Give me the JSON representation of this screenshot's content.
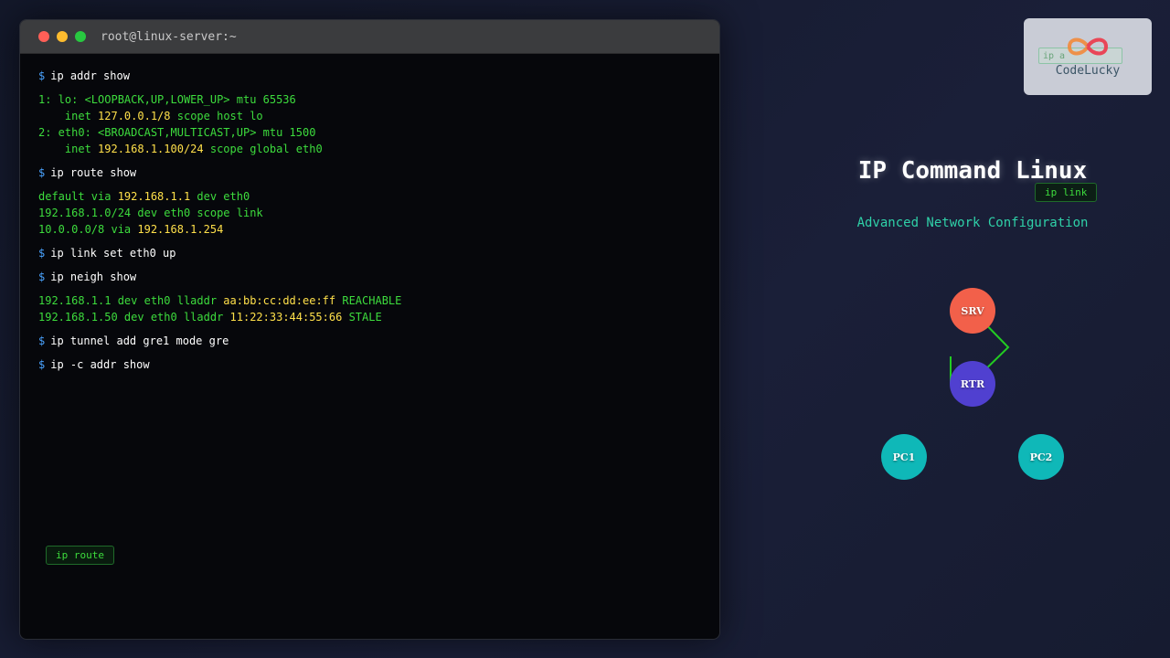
{
  "terminal": {
    "title": "root@linux-server:~",
    "prompt": "$",
    "commands": [
      {
        "cmd": "ip addr show"
      },
      {
        "cmd": "ip route show"
      },
      {
        "cmd": "ip link set eth0 up"
      },
      {
        "cmd": "ip neigh show"
      },
      {
        "cmd": "ip tunnel add gre1 mode gre"
      },
      {
        "cmd": "ip -c addr show"
      }
    ],
    "addr_output": {
      "l1": "1: lo: <LOOPBACK,UP,LOWER_UP> mtu 65536",
      "l2_pre": "    inet ",
      "l2_ip": "127.0.0.1/8",
      "l2_post": " scope host lo",
      "l3": "2: eth0: <BROADCAST,MULTICAST,UP> mtu 1500",
      "l4_pre": "    inet ",
      "l4_ip": "192.168.1.100/24",
      "l4_post": " scope global eth0"
    },
    "route_output": {
      "l1_pre": "default via ",
      "l1_ip": "192.168.1.1",
      "l1_post": " dev eth0",
      "l2": "192.168.1.0/24 dev eth0 scope link",
      "l3_pre": "10.0.0.0/8 via ",
      "l3_ip": "192.168.1.254"
    },
    "neigh_output": {
      "l1_pre": "192.168.1.1 dev eth0 lladdr ",
      "l1_mac": "aa:bb:cc:dd:ee:ff",
      "l1_state": " REACHABLE",
      "l2_pre": "192.168.1.50 dev eth0 lladdr ",
      "l2_mac": "11:22:33:44:55:66",
      "l2_state": " STALE"
    }
  },
  "chips": {
    "ip_route": "ip route",
    "ip_link": "ip link",
    "logo_chip": "ip a"
  },
  "brand": {
    "name": "CodeLucky"
  },
  "hero": {
    "title": "IP Command Linux",
    "subtitle": "Advanced Network Configuration"
  },
  "topology": {
    "nodes": [
      {
        "label": "SRV",
        "color": "#f2604a"
      },
      {
        "label": "RTR",
        "color": "#5040d0"
      },
      {
        "label": "PC1",
        "color": "#0fb8b8"
      },
      {
        "label": "PC2",
        "color": "#0fb8b8"
      }
    ],
    "link_color": "#22cc22"
  }
}
